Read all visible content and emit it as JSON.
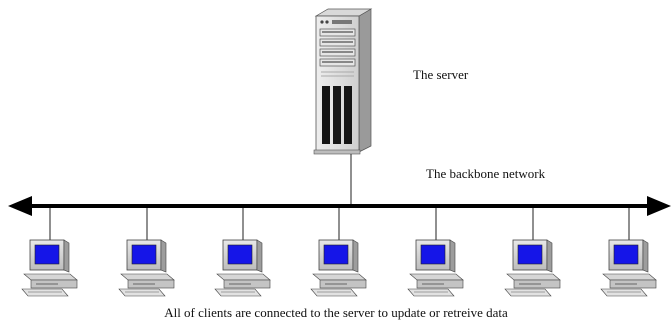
{
  "server": {
    "label": "The server",
    "icon": "server-tower-icon"
  },
  "backbone": {
    "label": "The backbone network",
    "icon": "double-arrow-line"
  },
  "clients": {
    "count": 7,
    "icon": "desktop-computer-icon",
    "screen_color": "#1515e8"
  },
  "caption": "All of clients are connected to the server to update or retreive data"
}
